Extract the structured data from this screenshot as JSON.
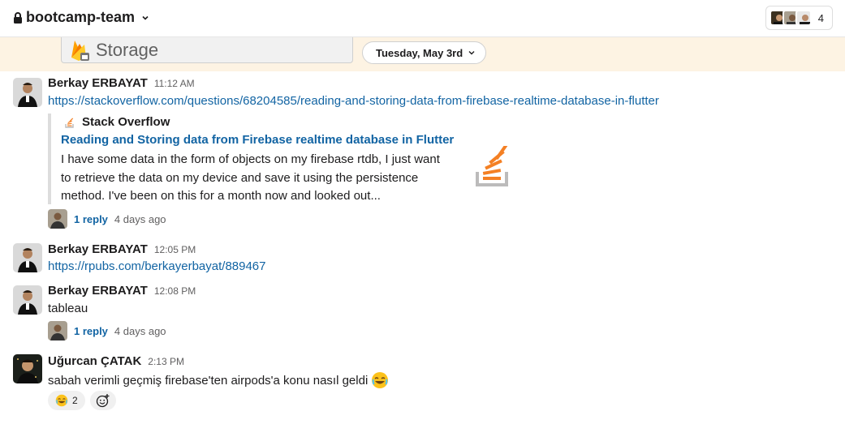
{
  "header": {
    "channel_name": "bootcamp-team",
    "member_count": "4"
  },
  "banner": {
    "storage_label": "Storage",
    "date": "Tuesday, May 3rd"
  },
  "messages": [
    {
      "author": "Berkay ERBAYAT",
      "time": "11:12 AM",
      "link": "https://stackoverflow.com/questions/68204585/reading-and-storing-data-from-firebase-realtime-database-in-flutter",
      "unfurl": {
        "site": "Stack Overflow",
        "title": "Reading and Storing data from Firebase realtime database in Flutter",
        "desc1": "I have some data in the form of objects on my firebase rtdb, I just want",
        "desc2": "to retrieve the data on my device and save it using the persistence",
        "desc3": "method. I've been on this for a month now and looked out..."
      },
      "thread": {
        "replies": "1 reply",
        "ago": "4 days ago"
      }
    },
    {
      "author": "Berkay ERBAYAT",
      "time": "12:05 PM",
      "link": "https://rpubs.com/berkayerbayat/889467"
    },
    {
      "author": "Berkay ERBAYAT",
      "time": "12:08 PM",
      "text": "tableau",
      "thread": {
        "replies": "1 reply",
        "ago": "4 days ago"
      }
    },
    {
      "author": "Uğurcan ÇATAK",
      "time": "2:13 PM",
      "text": "sabah verimli geçmiş firebase'ten airpods'a konu nasıl geldi",
      "reaction": {
        "emoji": "joy-emoji",
        "count": "2"
      }
    }
  ],
  "icons": {
    "lock": "lock-icon",
    "chevron": "chevron-down-icon",
    "add_reaction": "add-reaction-icon",
    "stackoverflow": "stackoverflow-icon",
    "firebase": "firebase-icon"
  },
  "colors": {
    "link": "#1264a3",
    "banner_bg": "#fdf3e3",
    "stackoverflow": "#f48024"
  }
}
